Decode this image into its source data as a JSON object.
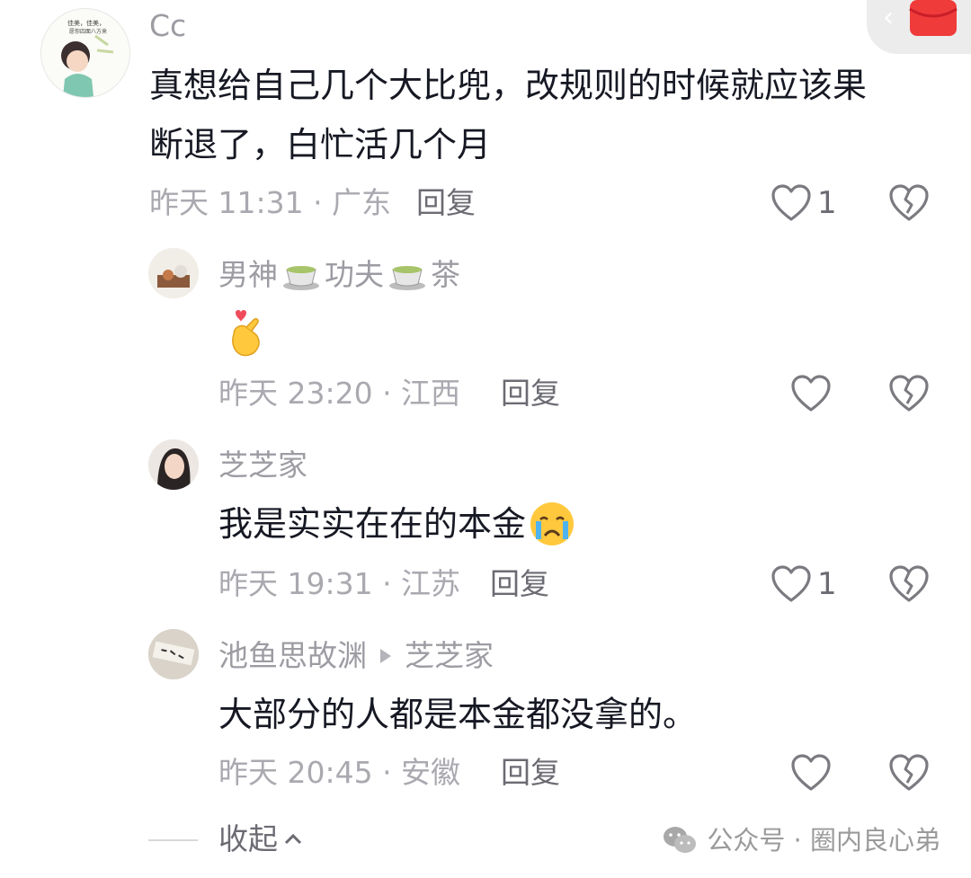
{
  "comments": [
    {
      "user": "Cc",
      "text_line1": "真想给自己几个大比兜，改规则的时候就应该果",
      "text_line2": "断退了，白忙活几个月",
      "time_location": "昨天 11:31 · 广东",
      "reply_label": "回复",
      "like_count": "1"
    },
    {
      "user_part1": "男神",
      "user_part2": "功夫",
      "user_part3": "茶",
      "user_emoji": "tea-cup-icon",
      "text_emoji": "finger-heart-icon",
      "time_location": "昨天 23:20 · 江西",
      "reply_label": "回复",
      "like_count": ""
    },
    {
      "user": "芝芝家",
      "text": "我是实实在在的本金",
      "text_emoji": "crying-face-icon",
      "time_location": "昨天 19:31 · 江苏",
      "reply_label": "回复",
      "like_count": "1"
    },
    {
      "user": "池鱼思故渊",
      "reply_to": "芝芝家",
      "text": "大部分的人都是本金都没拿的。",
      "time_location": "昨天 20:45 · 安徽",
      "reply_label": "回复",
      "like_count": ""
    }
  ],
  "collapse_label": "收起",
  "watermark": {
    "label": "公众号 · 圈内良心弟",
    "icon": "wechat-icon"
  },
  "colors": {
    "text": "#161823",
    "meta": "#a9a9b0",
    "name": "#9c9ca3"
  }
}
